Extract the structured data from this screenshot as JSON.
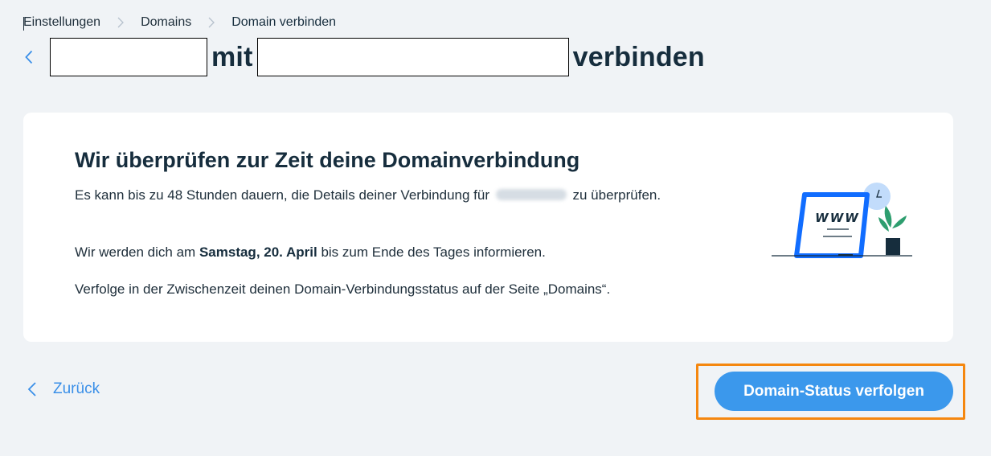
{
  "breadcrumb": {
    "items": [
      "Einstellungen",
      "Domains",
      "Domain verbinden"
    ]
  },
  "header": {
    "word_with": "mit",
    "word_connect": "verbinden"
  },
  "card": {
    "heading": "Wir überprüfen zur Zeit deine Domainverbindung",
    "p1_before": "Es kann bis zu 48 Stunden dauern, die Details deiner Verbindung für",
    "p1_after": "zu überprüfen.",
    "p2_before": "Wir werden dich am",
    "p2_date": "Samstag, 20. April",
    "p2_after": "bis zum Ende des Tages informieren.",
    "p3": "Verfolge in der Zwischenzeit deinen Domain-Verbindungsstatus auf der Seite „Domains“.",
    "illustration_text": "WWW"
  },
  "footer": {
    "back_label": "Zurück",
    "primary_label": "Domain-Status verfolgen"
  },
  "colors": {
    "background": "#f0f3f6",
    "text_dark": "#162d3d",
    "accent_blue": "#3b98ec",
    "link_blue": "#3a8fe8",
    "highlight_orange": "#f5870f"
  }
}
